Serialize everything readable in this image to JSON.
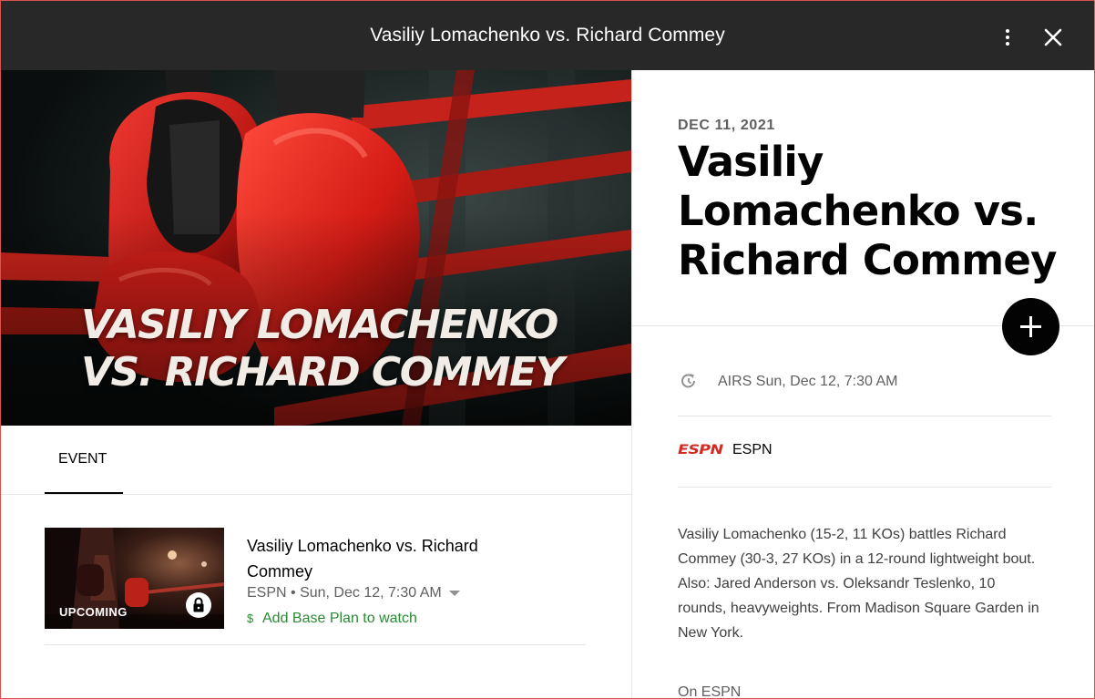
{
  "window": {
    "title": "Vasiliy Lomachenko vs. Richard Commey"
  },
  "hero": {
    "line1": "VASILIY LOMACHENKO",
    "line2": "VS. RICHARD COMMEY"
  },
  "tabs": [
    {
      "label": "EVENT",
      "selected": true
    }
  ],
  "program": {
    "badge": "UPCOMING",
    "title": "Vasiliy Lomachenko vs. Richard Commey",
    "meta": "ESPN • Sun, Dec 12, 7:30 AM",
    "plan_link": "Add Base Plan to watch",
    "icons": [
      "lock-icon",
      "dollar-icon",
      "caret-down-icon"
    ]
  },
  "detail": {
    "date": "DEC 11, 2021",
    "title": "Vasiliy Lomachenko vs. Richard Commey",
    "airs": "AIRS Sun, Dec 12, 7:30 AM",
    "network_logo": "ESPN",
    "network_name": "ESPN",
    "description": "Vasiliy Lomachenko (15-2, 11 KOs) battles Richard Commey (30-3, 27 KOs) in a 12-round lightweight bout. Also: Jared Anderson vs. Oleksandr Teslenko, 10 rounds, heavyweights. From Madison Square Garden in New York.",
    "on_network": "On ESPN"
  },
  "colors": {
    "header_bg": "#282828",
    "accent_green": "#2b8a34",
    "espn_red": "#d12b22",
    "add_button": "#030303"
  }
}
